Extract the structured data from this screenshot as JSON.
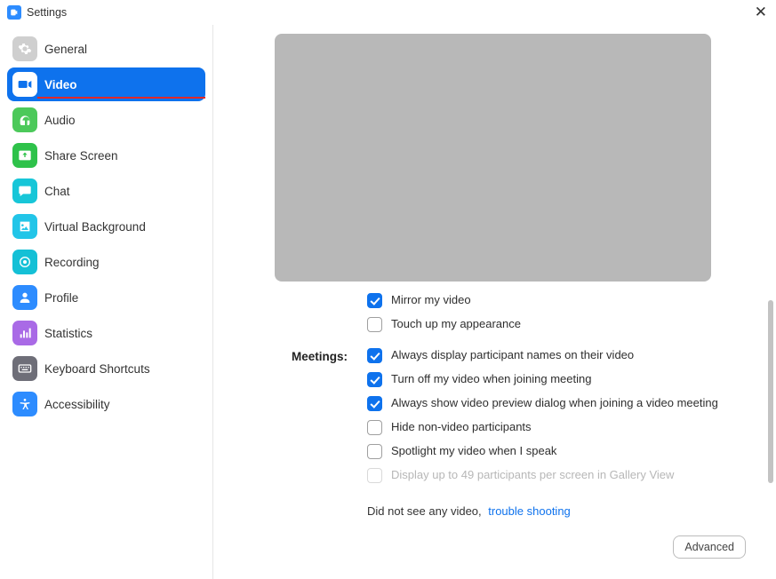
{
  "window": {
    "title": "Settings"
  },
  "sidebar": {
    "items": [
      {
        "label": "General"
      },
      {
        "label": "Video"
      },
      {
        "label": "Audio"
      },
      {
        "label": "Share Screen"
      },
      {
        "label": "Chat"
      },
      {
        "label": "Virtual Background"
      },
      {
        "label": "Recording"
      },
      {
        "label": "Profile"
      },
      {
        "label": "Statistics"
      },
      {
        "label": "Keyboard Shortcuts"
      },
      {
        "label": "Accessibility"
      }
    ],
    "active_index": 1
  },
  "video_settings": {
    "section_meetings_label": "Meetings:",
    "options": {
      "mirror_my_video": {
        "label": "Mirror my video",
        "checked": true
      },
      "touch_up": {
        "label": "Touch up my appearance",
        "checked": false
      },
      "always_display_names": {
        "label": "Always display participant names on their video",
        "checked": true
      },
      "turn_off_on_join": {
        "label": "Turn off my video when joining meeting",
        "checked": true
      },
      "always_show_preview": {
        "label": "Always show video preview dialog when joining a video meeting",
        "checked": true
      },
      "hide_non_video": {
        "label": "Hide non-video participants",
        "checked": false
      },
      "spotlight_when_speak": {
        "label": "Spotlight my video when I speak",
        "checked": false
      },
      "gallery_49": {
        "label": "Display up to 49 participants per screen in Gallery View",
        "checked": false,
        "disabled": true
      }
    },
    "troubleshoot_prefix": "Did not see any video,",
    "troubleshoot_link": "trouble shooting",
    "advanced_button": "Advanced"
  }
}
